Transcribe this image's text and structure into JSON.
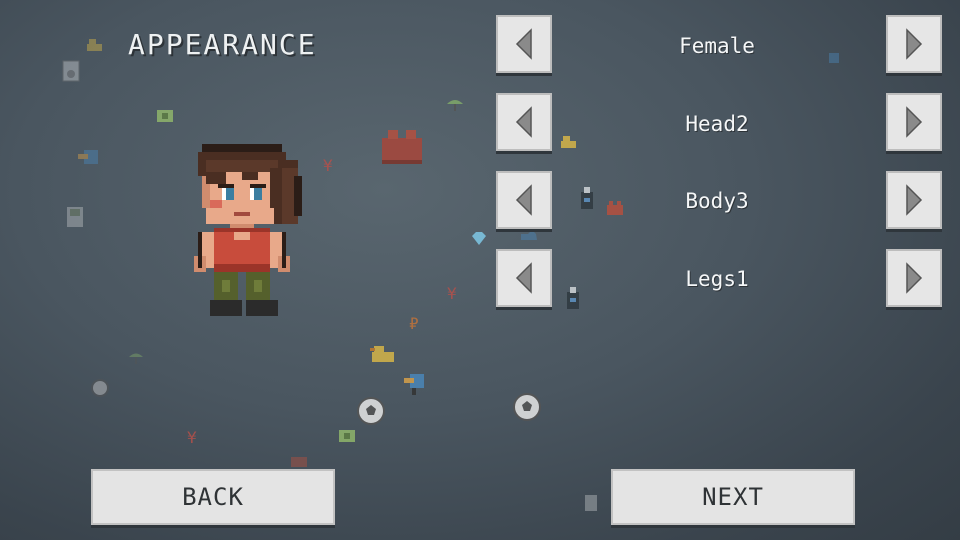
{
  "screen": {
    "title": "APPEARANCE"
  },
  "options": [
    {
      "id": "gender",
      "value": "Female"
    },
    {
      "id": "head",
      "value": "Head2"
    },
    {
      "id": "body",
      "value": "Body3"
    },
    {
      "id": "legs",
      "value": "Legs1"
    }
  ],
  "buttons": {
    "back": "BACK",
    "next": "NEXT"
  },
  "icons": {
    "prev": "triangle-left-icon",
    "next": "triangle-right-icon"
  },
  "colors": {
    "button_face": "#e6e6e6",
    "arrow": "#8a8a8a",
    "text_light": "#f5f7f8"
  }
}
